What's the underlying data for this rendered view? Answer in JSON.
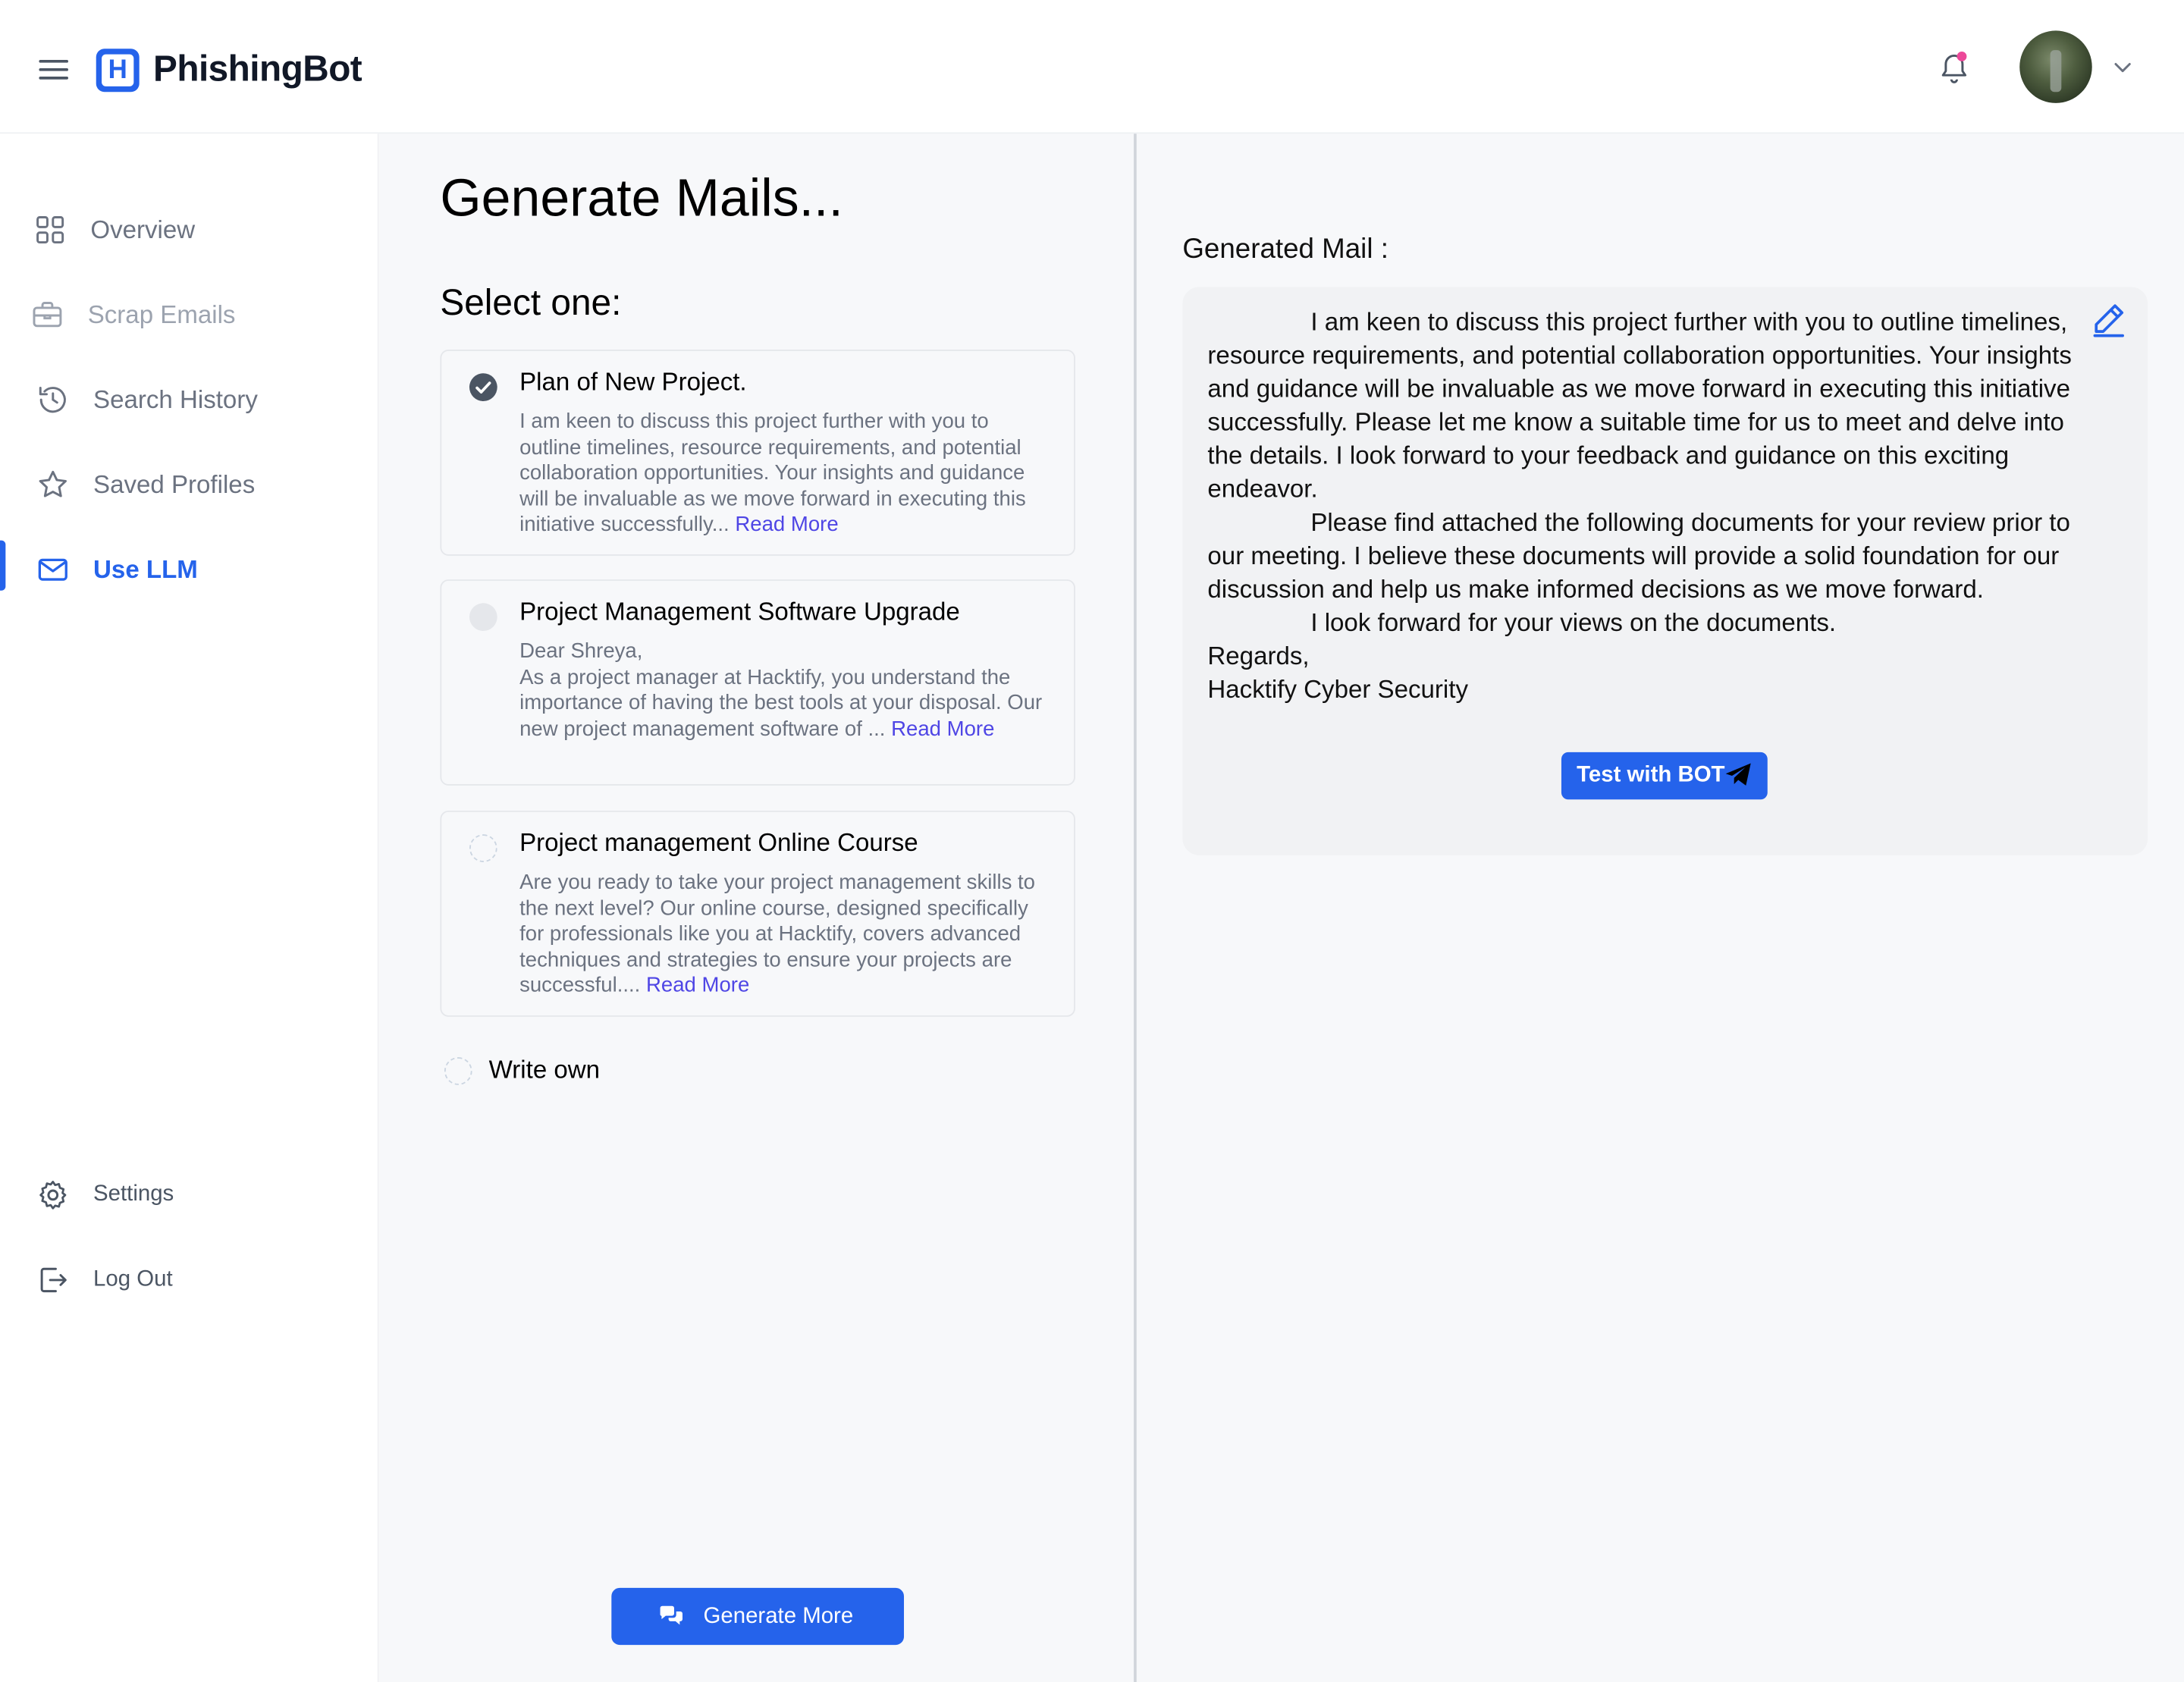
{
  "header": {
    "brand": "PhishingBot",
    "colors": {
      "brand": "#2563eb",
      "notification_dot": "#ec4899"
    }
  },
  "sidebar": {
    "items": [
      {
        "label": "Overview",
        "icon": "grid-icon"
      },
      {
        "label": "Scrap Emails",
        "icon": "briefcase-icon"
      },
      {
        "label": "Search History",
        "icon": "history-icon"
      },
      {
        "label": "Saved Profiles",
        "icon": "star-icon"
      },
      {
        "label": "Use LLM",
        "icon": "mail-icon",
        "active": true
      }
    ],
    "bottom": [
      {
        "label": "Settings",
        "icon": "gear-icon"
      },
      {
        "label": "Log Out",
        "icon": "logout-icon"
      }
    ]
  },
  "main": {
    "title": "Generate Mails...",
    "select_label": "Select one:",
    "options": [
      {
        "title": "Plan of New Project.",
        "body": "I am keen to discuss this project further with you to outline timelines, resource requirements, and potential collaboration opportunities. Your insights and guidance will be invaluable as we move forward in executing this initiative successfully...",
        "read_more": "Read More",
        "state": "selected"
      },
      {
        "title": "Project Management Software Upgrade",
        "body_greeting": "Dear Shreya,",
        "body": "As a project manager at Hacktify, you understand the importance of having the best tools at your disposal. Our new project management software of ...",
        "read_more": "Read More",
        "state": "unselected"
      },
      {
        "title": "Project management Online Course",
        "body": "Are you ready to take your project management skills to the next level? Our online course, designed specifically for professionals like you at Hacktify, covers advanced techniques and strategies to ensure your projects are successful....",
        "read_more": "Read More",
        "state": "unselected"
      }
    ],
    "write_own": "Write own",
    "generate_more": "Generate More"
  },
  "generated": {
    "label": "Generated Mail :",
    "paragraphs": [
      "I am keen to discuss this project further with you to outline timelines, resource requirements, and potential collaboration opportunities. Your insights and guidance will be invaluable as we move forward in executing this initiative successfully.  Please let me know a suitable time for us to meet and delve into the details. I look forward to your feedback and guidance on this exciting endeavor.",
      "Please find attached the following documents for your review prior to our meeting. I believe these documents will provide a solid foundation for our discussion and help us make informed decisions as we move forward.",
      "I look forward for your views on the documents."
    ],
    "closing": "Regards,",
    "signature": "Hacktify Cyber Security",
    "test_button": "Test with BOT"
  }
}
